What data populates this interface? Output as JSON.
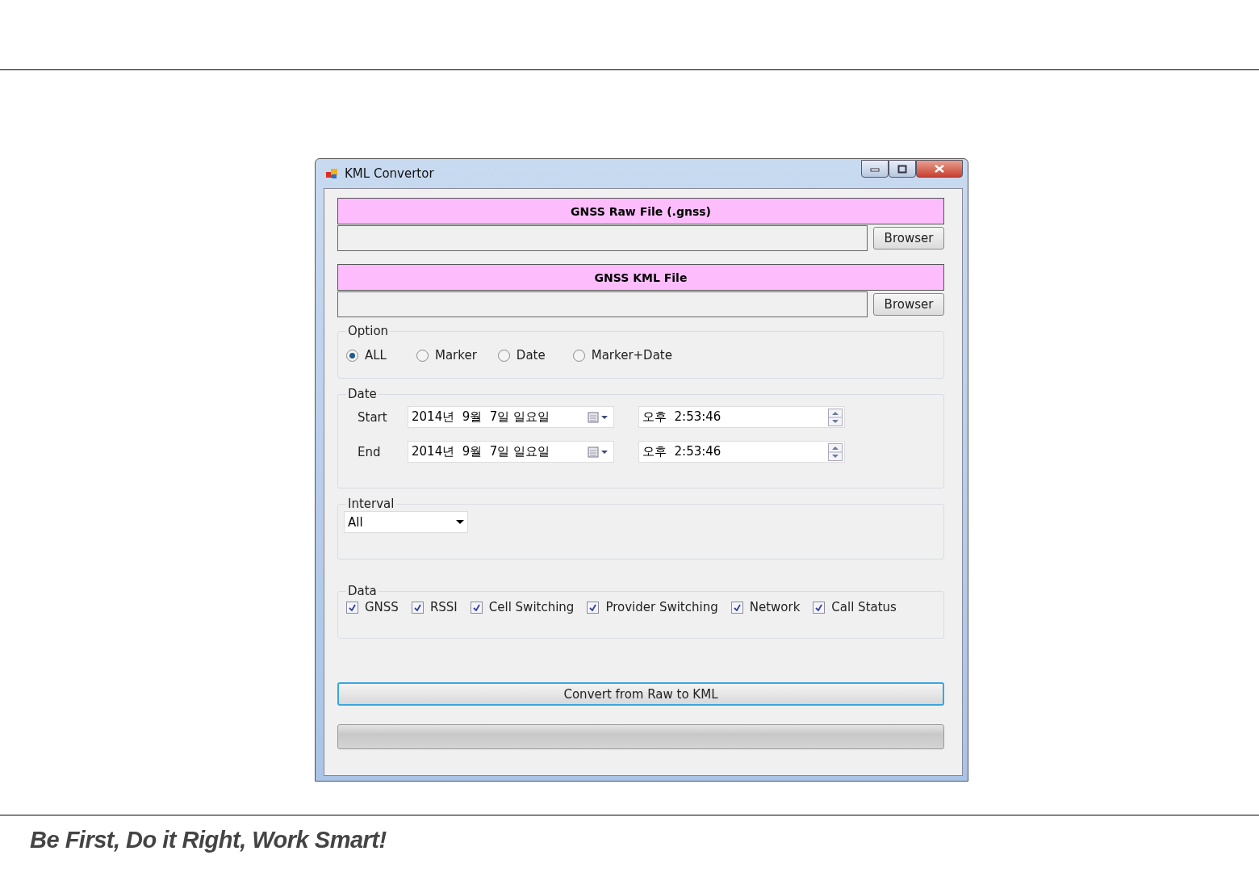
{
  "window": {
    "title": "KML Convertor"
  },
  "files": [
    {
      "header": "GNSS Raw File (.gnss)",
      "button": "Browser"
    },
    {
      "header": "GNSS KML File",
      "button": "Browser"
    }
  ],
  "option": {
    "title": "Option",
    "radios": [
      {
        "label": "ALL",
        "selected": true
      },
      {
        "label": "Marker",
        "selected": false
      },
      {
        "label": "Date",
        "selected": false
      },
      {
        "label": "Marker+Date",
        "selected": false
      }
    ]
  },
  "date": {
    "title": "Date",
    "rows": [
      {
        "label": "Start",
        "date": "2014년  9월  7일 일요일",
        "time": "오후  2:53:46"
      },
      {
        "label": "End",
        "date": "2014년  9월  7일 일요일",
        "time": "오후  2:53:46"
      }
    ]
  },
  "interval": {
    "title": "Interval",
    "value": "All"
  },
  "data": {
    "title": "Data",
    "checks": [
      {
        "label": "GNSS",
        "checked": true
      },
      {
        "label": "RSSI",
        "checked": true
      },
      {
        "label": "Cell Switching",
        "checked": true
      },
      {
        "label": "Provider Switching",
        "checked": true
      },
      {
        "label": "Network",
        "checked": true
      },
      {
        "label": "Call Status",
        "checked": true
      }
    ]
  },
  "convert_button": "Convert from Raw to KML",
  "progress": {
    "level": 0
  },
  "slide": {
    "tagline": "Be First, Do it Right, Work Smart!"
  }
}
